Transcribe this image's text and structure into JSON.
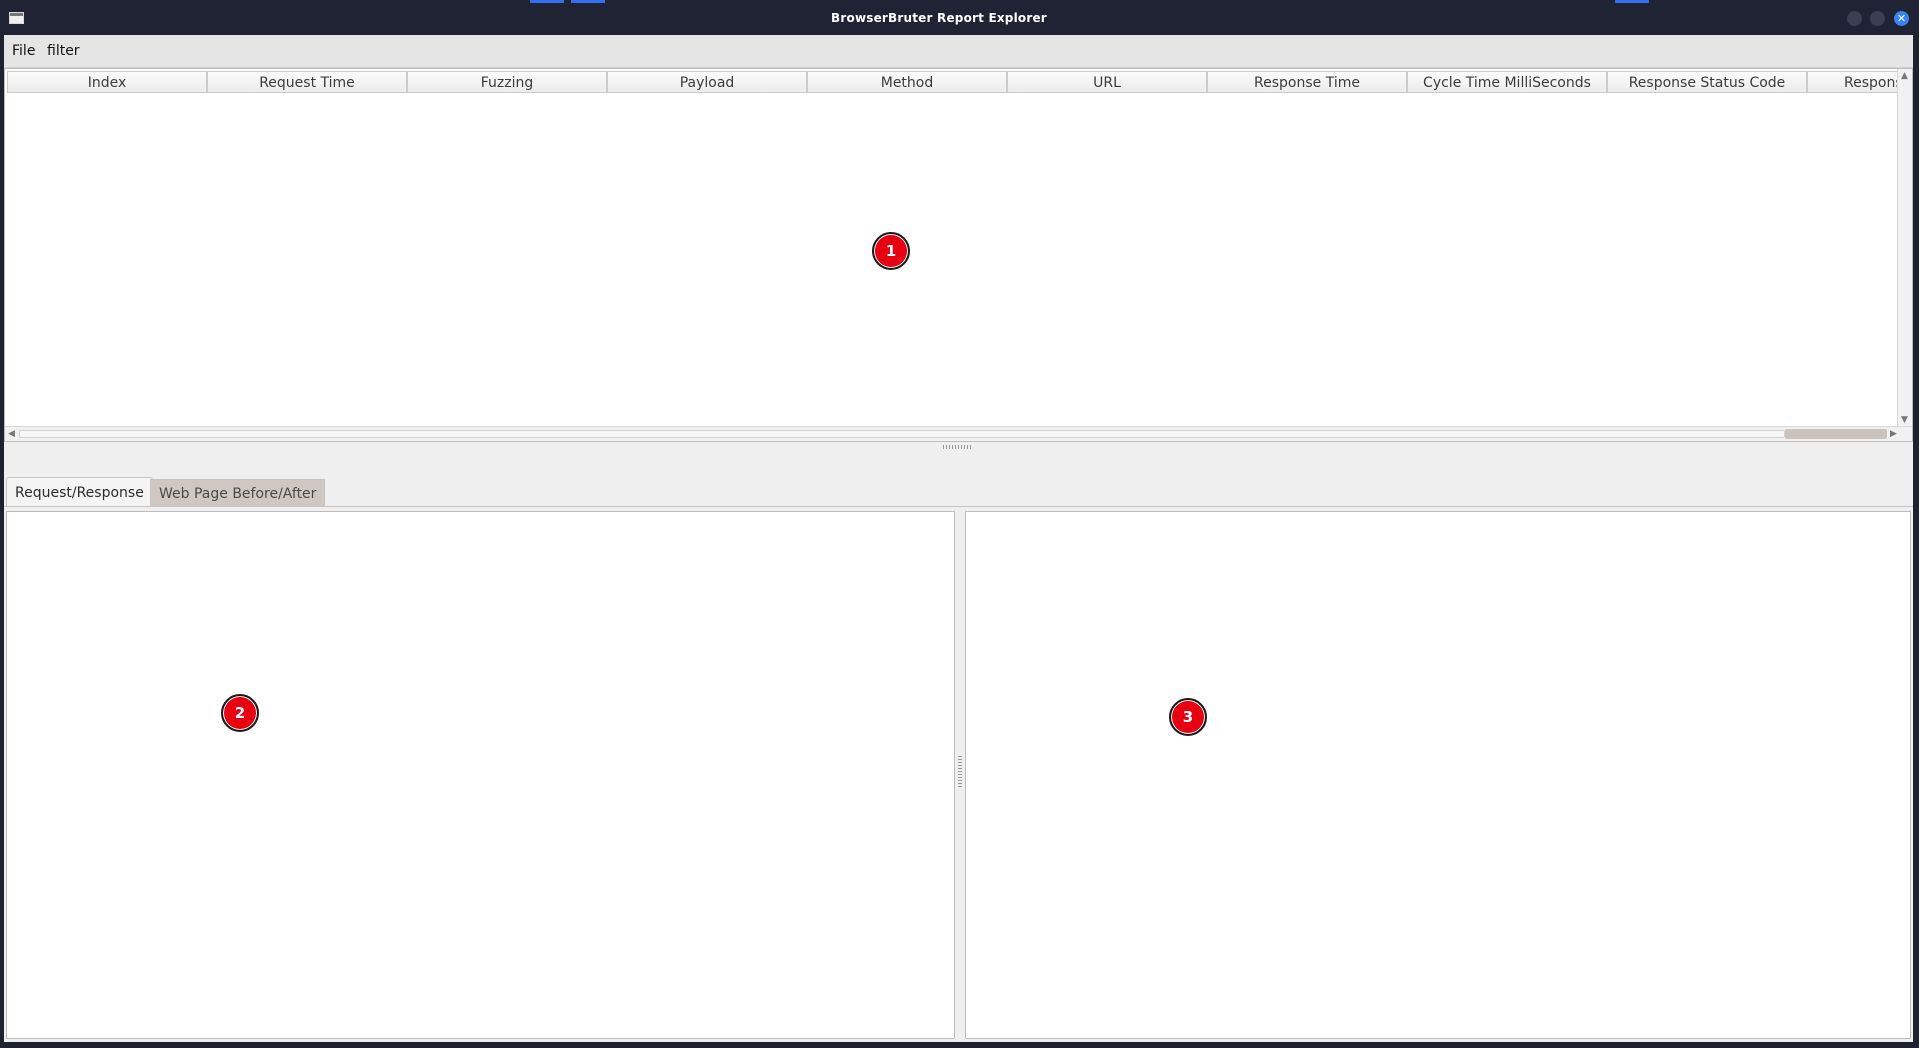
{
  "window": {
    "title": "BrowserBruter Report Explorer",
    "close_glyph": "✕",
    "accent_color": "#2f6ff0"
  },
  "menubar": {
    "items": [
      {
        "label": "File"
      },
      {
        "label": "filter"
      }
    ]
  },
  "table": {
    "columns": [
      "Index",
      "Request Time",
      "Fuzzing",
      "Payload",
      "Method",
      "URL",
      "Response Time",
      "Cycle Time MilliSeconds",
      "Response Status Code",
      "Respons"
    ],
    "rows": []
  },
  "tabs": [
    {
      "label": "Request/Response",
      "selected": true
    },
    {
      "label": "Web Page Before/After",
      "selected": false
    }
  ],
  "markers": [
    {
      "label": "1",
      "color": "#e60012"
    },
    {
      "label": "2",
      "color": "#e60012"
    },
    {
      "label": "3",
      "color": "#e60012"
    }
  ],
  "icons": {
    "app": "window-icon",
    "scroll_left": "◀",
    "scroll_right": "▶",
    "scroll_up": "▲",
    "scroll_down": "▼"
  }
}
